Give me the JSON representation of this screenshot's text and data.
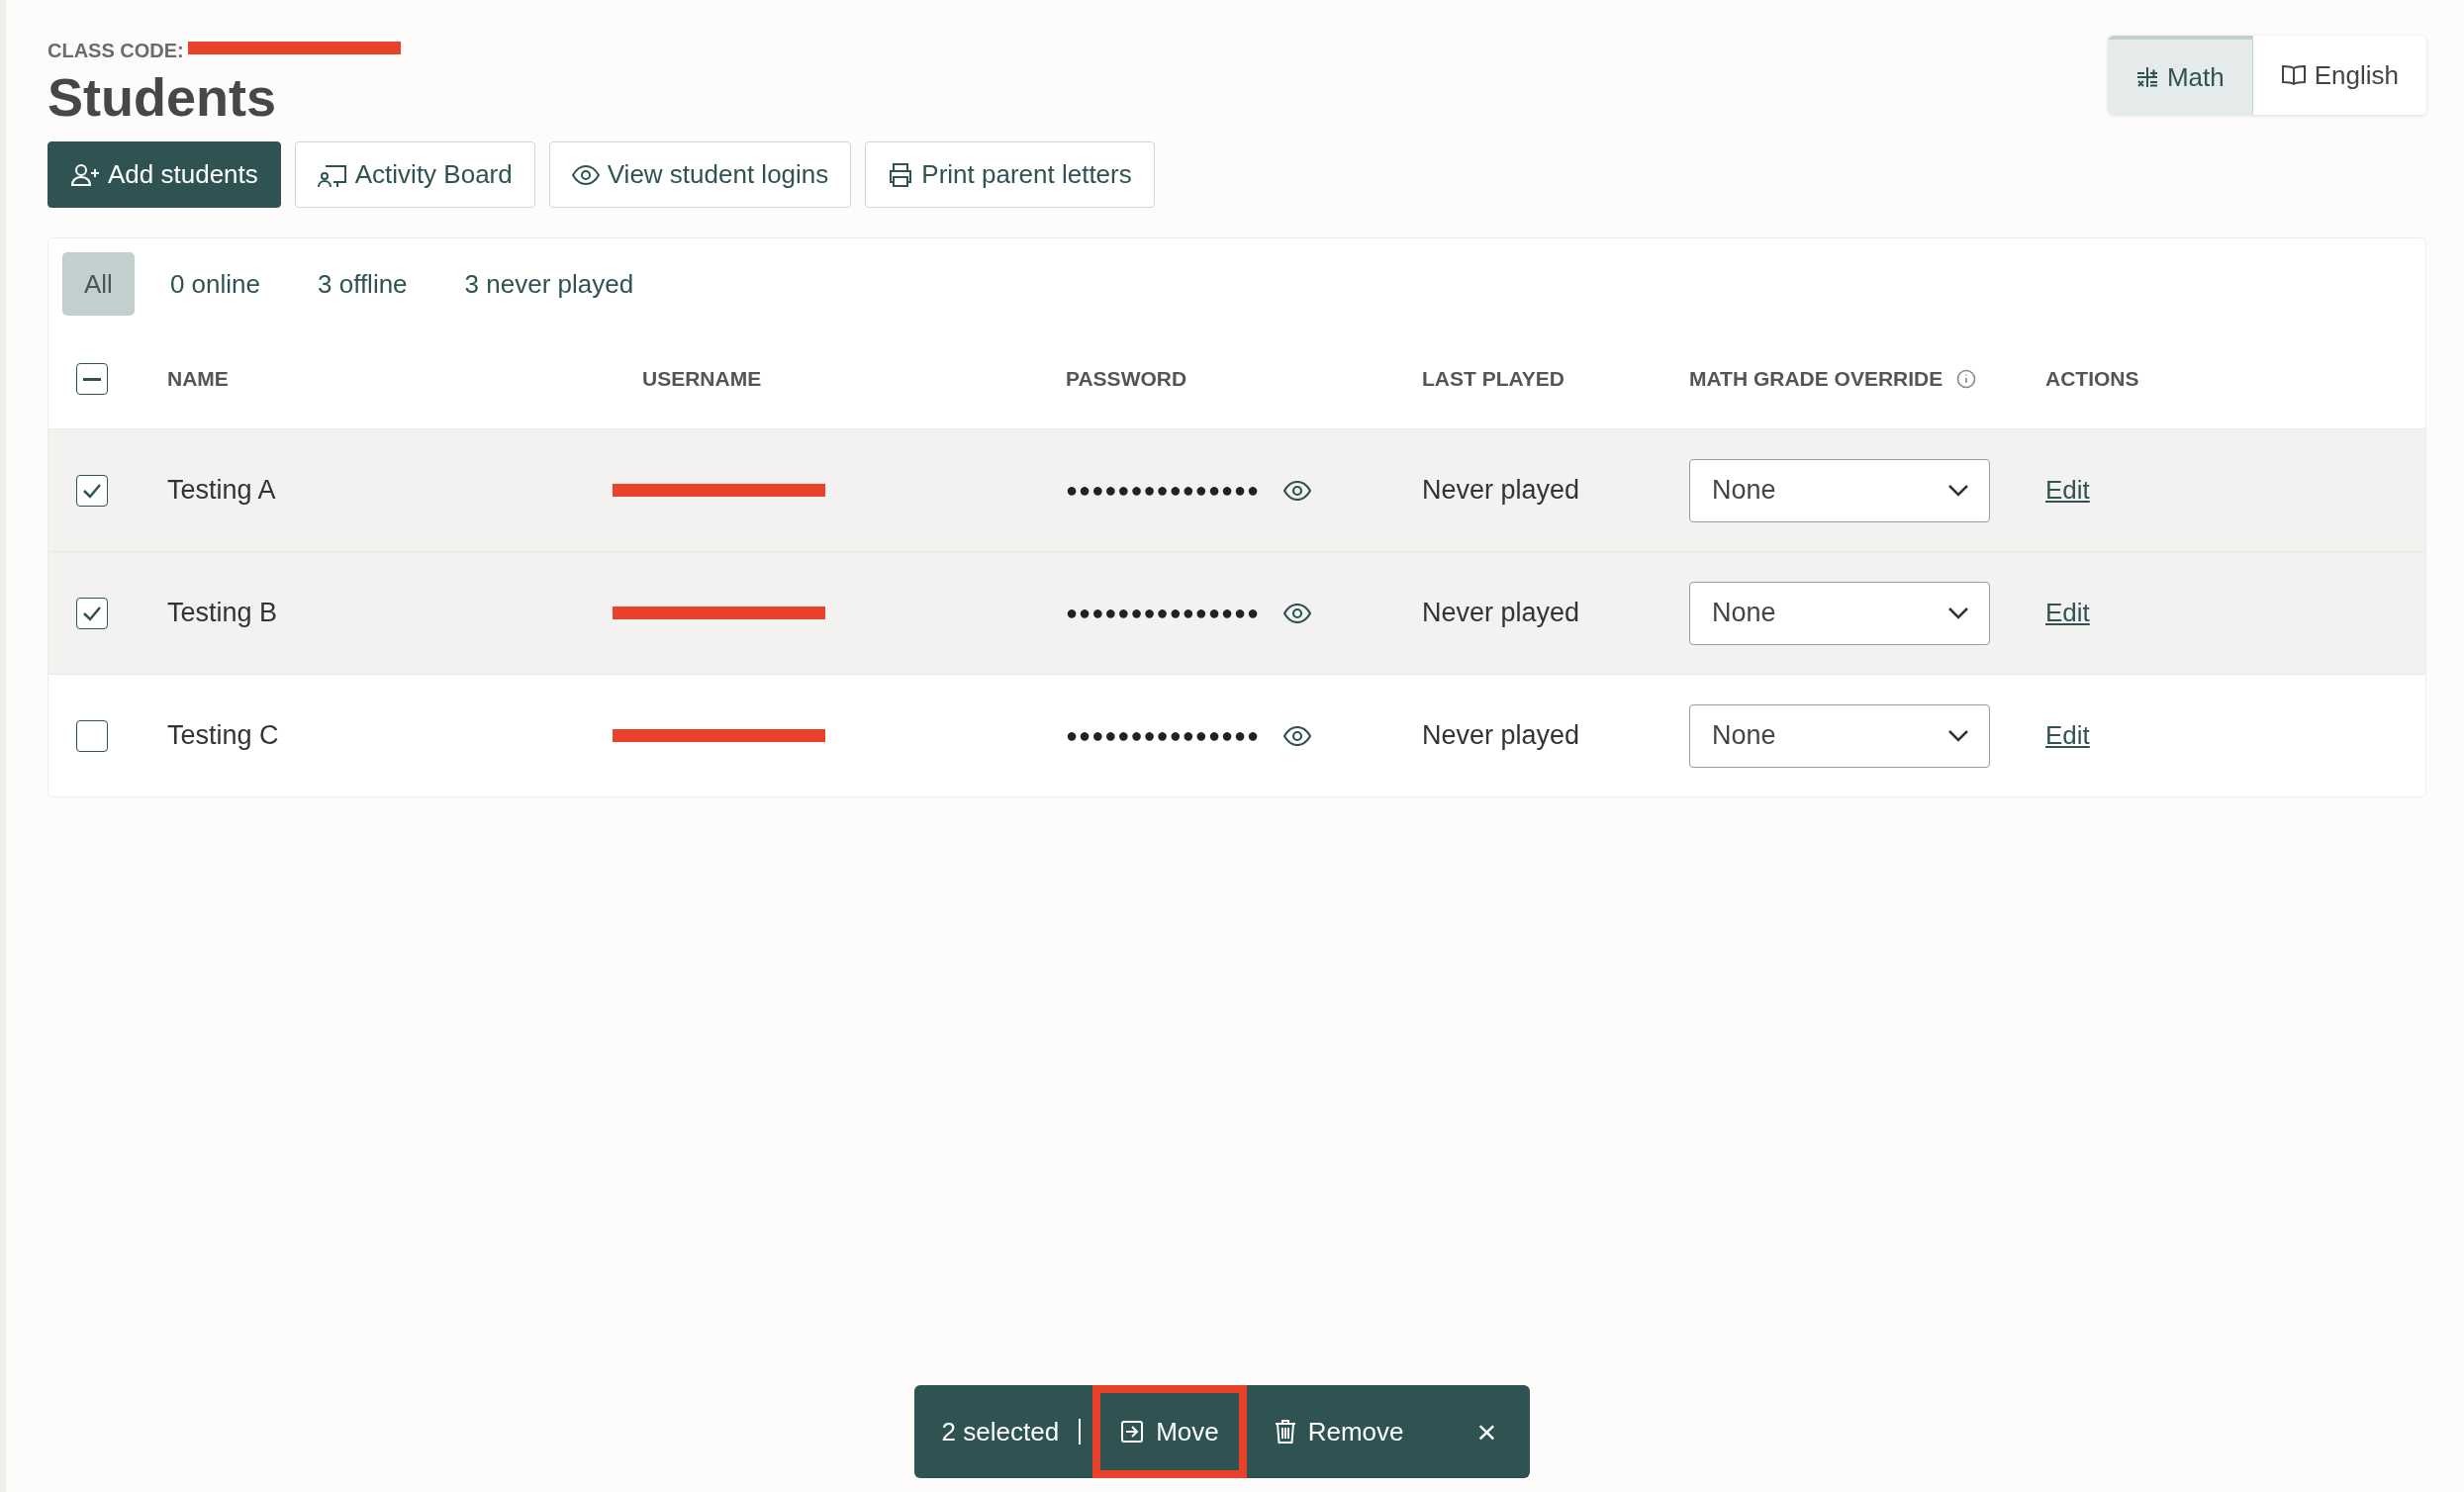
{
  "header": {
    "class_code_label": "CLASS CODE:",
    "class_code_redacted": true,
    "title": "Students"
  },
  "subject_tabs": [
    {
      "label": "Math",
      "kind": "math",
      "selected": true
    },
    {
      "label": "English",
      "kind": "book",
      "selected": false
    }
  ],
  "toolbar": [
    {
      "label": "Add students",
      "kind": "primary"
    },
    {
      "label": "Activity Board",
      "kind": "secondary"
    },
    {
      "label": "View student logins",
      "kind": "secondary"
    },
    {
      "label": "Print parent letters",
      "kind": "secondary"
    }
  ],
  "filters": [
    {
      "label": "All",
      "selected": true
    },
    {
      "label": "0 online",
      "selected": false
    },
    {
      "label": "3 offline",
      "selected": false
    },
    {
      "label": "3 never played",
      "selected": false
    }
  ],
  "table": {
    "select_all_indeterminate": true,
    "columns": [
      "NAME",
      "USERNAME",
      "PASSWORD",
      "LAST PLAYED",
      "MATH GRADE OVERRIDE",
      "ACTIONS"
    ],
    "rows": [
      {
        "checked": true,
        "name": "Testing A",
        "username_redacted": true,
        "password": "●●●●●●●●●●●●●●●",
        "last_played": "Never played",
        "grade_override": "None",
        "action": "Edit"
      },
      {
        "checked": true,
        "name": "Testing B",
        "username_redacted": true,
        "password": "●●●●●●●●●●●●●●●",
        "last_played": "Never played",
        "grade_override": "None",
        "action": "Edit"
      },
      {
        "checked": false,
        "name": "Testing C",
        "username_redacted": true,
        "password": "●●●●●●●●●●●●●●●",
        "last_played": "Never played",
        "grade_override": "None",
        "action": "Edit"
      }
    ]
  },
  "selection_bar": {
    "count": "2 selected",
    "actions": [
      {
        "label": "Move",
        "kind": "move",
        "highlighted": true
      },
      {
        "label": "Remove",
        "kind": "remove",
        "highlighted": false
      }
    ],
    "close": "×"
  }
}
